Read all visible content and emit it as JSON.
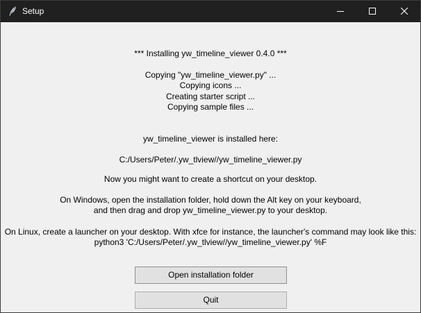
{
  "window": {
    "title": "Setup",
    "app_icon": "feather-icon",
    "controls": {
      "minimize_icon": "minimize-icon",
      "maximize_icon": "maximize-icon",
      "close_icon": "close-icon"
    }
  },
  "log": {
    "heading": "*** Installing yw_timeline_viewer 0.4.0 ***",
    "steps": [
      "Copying \"yw_timeline_viewer.py\" ...",
      "Copying icons ...",
      "Creating starter script ...",
      "Copying sample files ..."
    ],
    "installed_here": "yw_timeline_viewer is installed here:",
    "install_path": "C:/Users/Peter/.yw_tlview//yw_timeline_viewer.py",
    "shortcut_hint": "Now you might want to create a shortcut on your desktop.",
    "windows_hint_line1": "On Windows, open the installation folder, hold down the Alt key on your keyboard,",
    "windows_hint_line2": "and then drag and drop yw_timeline_viewer.py to your desktop.",
    "linux_hint_line1": "On Linux, create a launcher on your desktop. With xfce for instance, the launcher's command may look like this:",
    "linux_hint_line2": "python3 'C:/Users/Peter/.yw_tlview//yw_timeline_viewer.py' %F"
  },
  "buttons": {
    "open_folder_label": "Open installation folder",
    "quit_label": "Quit"
  }
}
